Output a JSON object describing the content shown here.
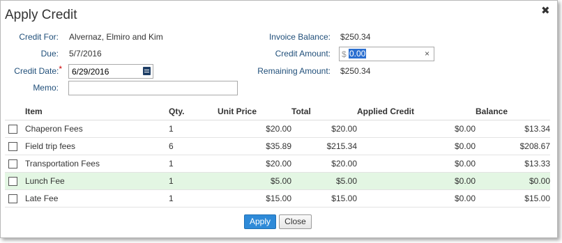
{
  "dialog": {
    "title": "Apply Credit",
    "close_glyph": "✖"
  },
  "form": {
    "credit_for_label": "Credit For:",
    "credit_for_value": "Alvernaz, Elmiro and Kim",
    "due_label": "Due:",
    "due_value": "5/7/2016",
    "credit_date_label": "Credit Date:",
    "credit_date_required": "*",
    "credit_date_value": "6/29/2016",
    "memo_label": "Memo:",
    "memo_value": "",
    "invoice_balance_label": "Invoice Balance:",
    "invoice_balance_value": "$250.34",
    "credit_amount_label": "Credit Amount:",
    "credit_amount_currency": "$",
    "credit_amount_value": "0.00",
    "remaining_amount_label": "Remaining Amount:",
    "remaining_amount_value": "$250.34"
  },
  "table": {
    "headers": {
      "item": "Item",
      "qty": "Qty.",
      "unit_price": "Unit Price",
      "total": "Total",
      "applied_credit": "Applied Credit",
      "balance": "Balance"
    },
    "rows": [
      {
        "item": "Chaperon Fees",
        "qty": "1",
        "unit_price": "$20.00",
        "total": "$20.00",
        "applied_credit": "$0.00",
        "balance": "$13.34"
      },
      {
        "item": "Field trip fees",
        "qty": "6",
        "unit_price": "$35.89",
        "total": "$215.34",
        "applied_credit": "$0.00",
        "balance": "$208.67"
      },
      {
        "item": "Transportation Fees",
        "qty": "1",
        "unit_price": "$20.00",
        "total": "$20.00",
        "applied_credit": "$0.00",
        "balance": "$13.33"
      },
      {
        "item": "Lunch Fee",
        "qty": "1",
        "unit_price": "$5.00",
        "total": "$5.00",
        "applied_credit": "$0.00",
        "balance": "$0.00"
      },
      {
        "item": "Late Fee",
        "qty": "1",
        "unit_price": "$15.00",
        "total": "$15.00",
        "applied_credit": "$0.00",
        "balance": "$15.00"
      }
    ],
    "highlight_color": "#e3f6e3"
  },
  "buttons": {
    "apply_label": "Apply",
    "close_label": "Close"
  },
  "colors": {
    "label": "#1f4e79",
    "apply_button": "#2e8ad8",
    "selection": "#2b6fd0",
    "required": "#cc0000"
  },
  "icons": {
    "calendar": "calendar-icon",
    "close": "close-icon",
    "clear": "clear-icon"
  }
}
